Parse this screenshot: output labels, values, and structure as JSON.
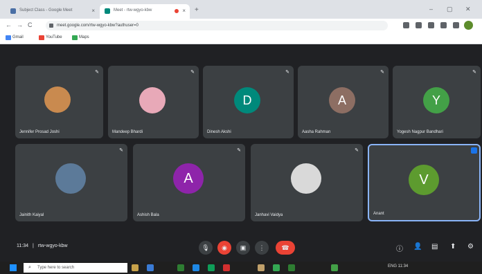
{
  "browser": {
    "tabs": [
      {
        "label": "Subject Class - Google Meet"
      },
      {
        "label": "Meet - rtw-wgyo-kbw"
      }
    ],
    "new_tab_symbol": "+",
    "close_symbol": "×",
    "nav": {
      "back": "←",
      "forward": "→",
      "reload": "C"
    },
    "url": "meet.google.com/rtw-wgyo-kbw?authuser=0",
    "window_controls": {
      "minimize": "–",
      "maximize": "▢",
      "close": "✕"
    },
    "bookmarks": [
      {
        "label": "Gmail",
        "color": "#4285f4"
      },
      {
        "label": "YouTube",
        "color": "#ea4335"
      },
      {
        "label": "Maps",
        "color": "#34a853"
      }
    ]
  },
  "meet": {
    "participants": [
      {
        "name": "Jennifer Prosad Joshi",
        "initial": "",
        "color": "#c98a4f",
        "kind": "photo"
      },
      {
        "name": "Mandeep Bhardi",
        "initial": "",
        "color": "#e8a9b8",
        "kind": "photo"
      },
      {
        "name": "Dinesh Akshi",
        "initial": "D",
        "color": "#00897b",
        "kind": "letter"
      },
      {
        "name": "Aasha Rahman",
        "initial": "A",
        "color": "#8d6e63",
        "kind": "letter"
      },
      {
        "name": "Yogesh Nagpur Bandhari",
        "initial": "Y",
        "color": "#43a047",
        "kind": "letter"
      },
      {
        "name": "Jainith Kaiyal",
        "initial": "",
        "color": "#5c7a99",
        "kind": "photo"
      },
      {
        "name": "Ashish Bala",
        "initial": "A",
        "color": "#8e24aa",
        "kind": "letter"
      },
      {
        "name": "Janhavi Vaidya",
        "initial": "",
        "color": "#d9d9d9",
        "kind": "photo"
      },
      {
        "name": "Anant",
        "initial": "V",
        "color": "#5d9b2f",
        "kind": "letter"
      }
    ],
    "mic_symbol": "✎",
    "meeting_time": "11:34",
    "meeting_code": "rtw-wgyo-kbw",
    "separator": "|",
    "controls": {
      "mic": "🎙",
      "camera": "◉",
      "captions": "▣",
      "more": "⋮",
      "hangup": "☎"
    },
    "right_controls": {
      "info": "ⓘ",
      "people": "👤",
      "chat": "▤",
      "activities": "⬆",
      "settings": "⚙"
    }
  },
  "taskbar": {
    "search_placeholder": "Type here to search",
    "search_symbol": "⌕",
    "tray": "ENG  11:34"
  }
}
